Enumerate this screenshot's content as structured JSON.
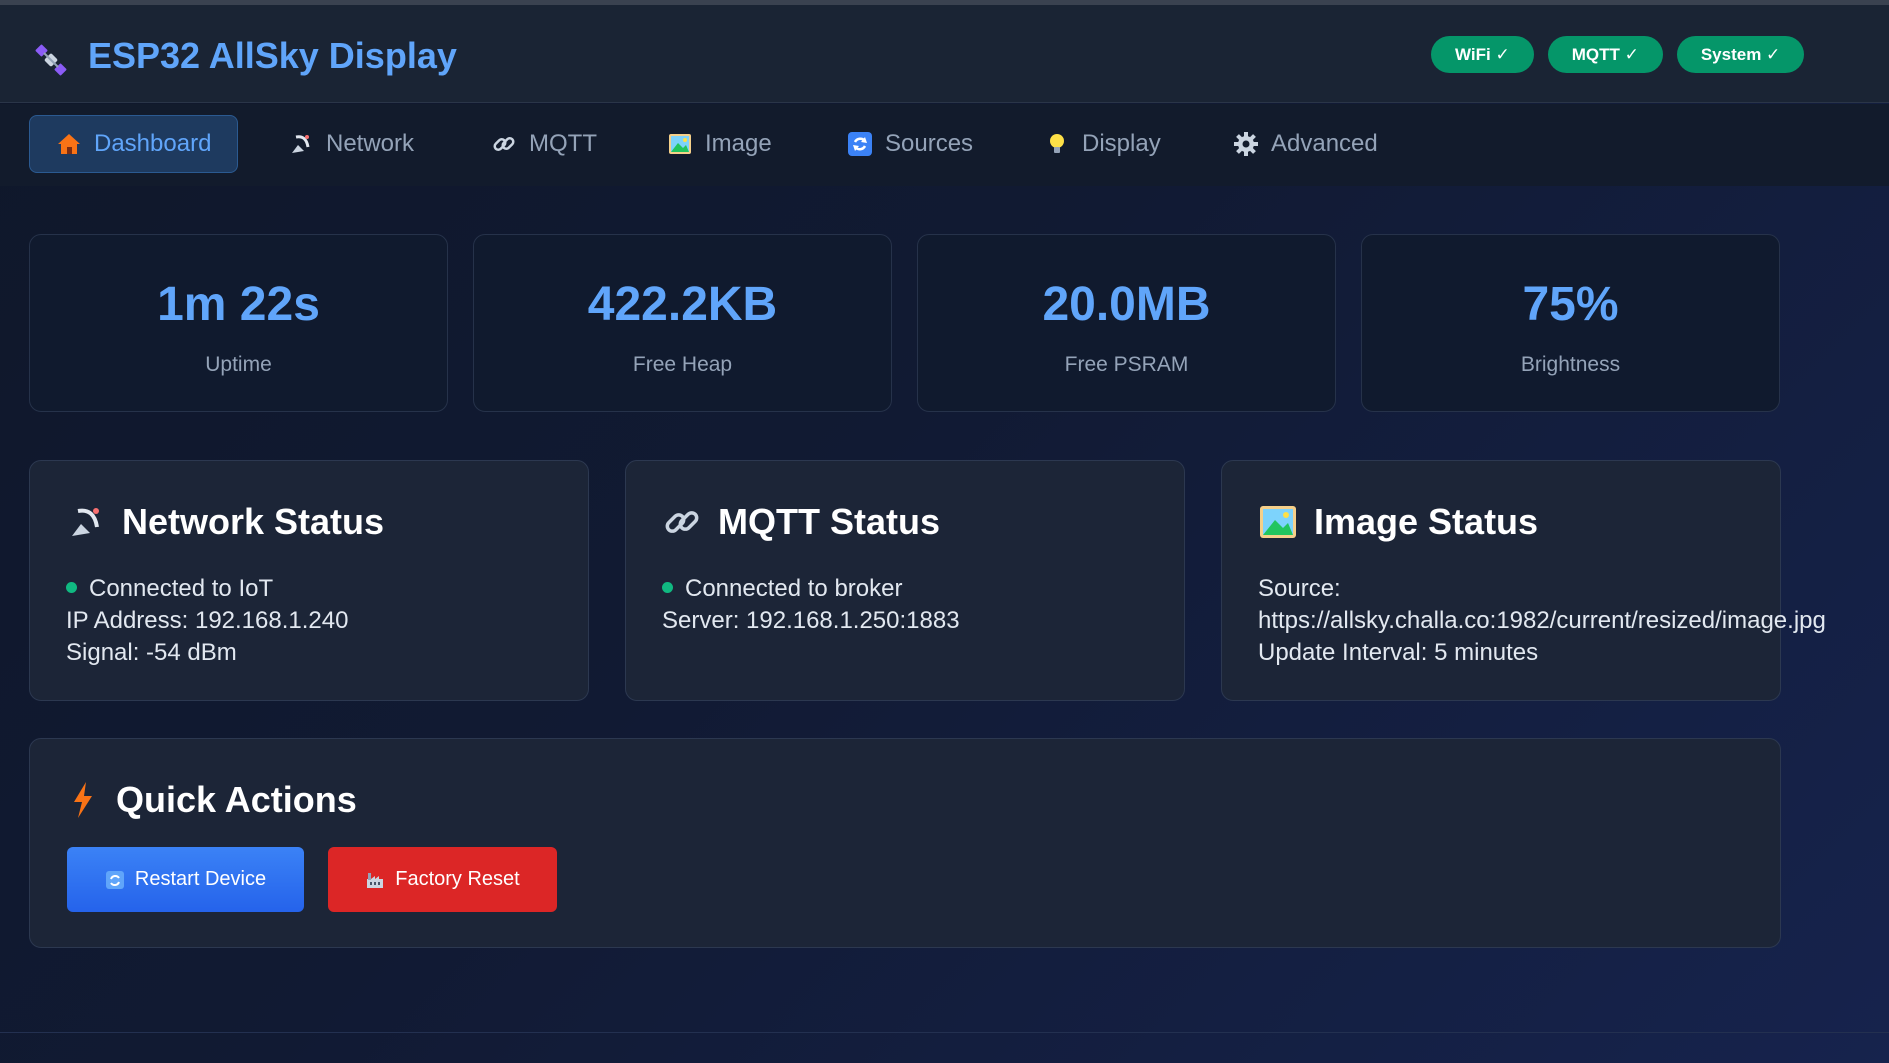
{
  "header": {
    "title": "ESP32 AllSky Display",
    "logo_icon": "satellite-icon",
    "badges": [
      {
        "label": "WiFi ✓"
      },
      {
        "label": "MQTT ✓"
      },
      {
        "label": "System ✓"
      }
    ]
  },
  "nav": {
    "tabs": [
      {
        "label": "Dashboard",
        "icon": "house-icon",
        "active": true
      },
      {
        "label": "Network",
        "icon": "satellite-dish-icon"
      },
      {
        "label": "MQTT",
        "icon": "link-icon"
      },
      {
        "label": "Image",
        "icon": "picture-icon"
      },
      {
        "label": "Sources",
        "icon": "refresh-icon"
      },
      {
        "label": "Display",
        "icon": "lightbulb-icon"
      },
      {
        "label": "Advanced",
        "icon": "gear-icon"
      }
    ]
  },
  "stats": [
    {
      "value": "1m 22s",
      "label": "Uptime"
    },
    {
      "value": "422.2KB",
      "label": "Free Heap"
    },
    {
      "value": "20.0MB",
      "label": "Free PSRAM"
    },
    {
      "value": "75%",
      "label": "Brightness"
    }
  ],
  "network_status": {
    "title": "Network Status",
    "connected": "Connected to IoT",
    "ip": "IP Address: 192.168.1.240",
    "signal": "Signal: -54 dBm"
  },
  "mqtt_status": {
    "title": "MQTT Status",
    "connected": "Connected to broker",
    "server": "Server: 192.168.1.250:1883"
  },
  "image_status": {
    "title": "Image Status",
    "source_label": "Source:",
    "source_url": "https://allsky.challa.co:1982/current/resized/image.jpg",
    "interval": "Update Interval: 5 minutes"
  },
  "quick_actions": {
    "title": "Quick Actions",
    "restart_label": "Restart Device",
    "reset_label": "Factory Reset"
  },
  "colors": {
    "accent": "#60a5fa",
    "success": "#059669",
    "danger": "#dc2626",
    "primary_button": "#3b82f6"
  }
}
